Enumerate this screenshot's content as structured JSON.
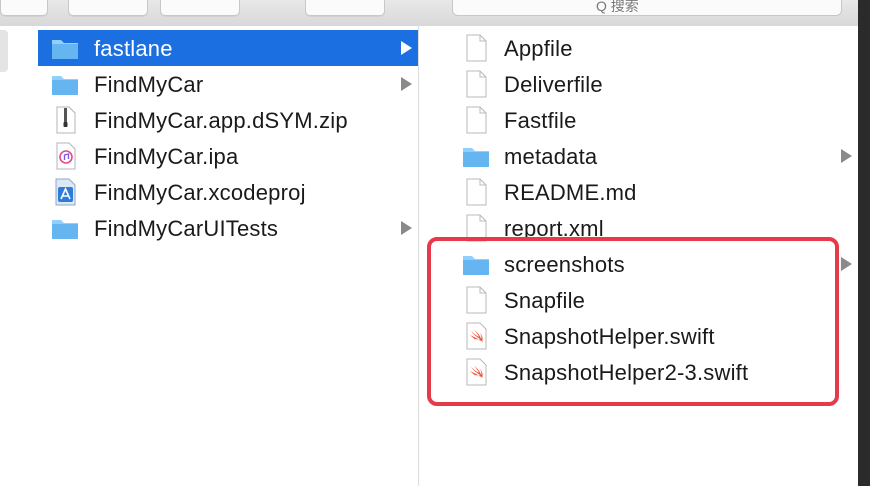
{
  "window": {
    "search_label": "Q 搜索"
  },
  "accent": {
    "selection": "#1c6fe0",
    "annotation": "#e63a4a",
    "folder": "#64b5f0"
  },
  "column1": {
    "items": [
      {
        "label": "fastlane",
        "icon": "folder-icon",
        "selected": true,
        "has_children": true
      },
      {
        "label": "FindMyCar",
        "icon": "folder-icon",
        "selected": false,
        "has_children": true
      },
      {
        "label": "FindMyCar.app.dSYM.zip",
        "icon": "zip-file-icon",
        "selected": false,
        "has_children": false
      },
      {
        "label": "FindMyCar.ipa",
        "icon": "ipa-file-icon",
        "selected": false,
        "has_children": false
      },
      {
        "label": "FindMyCar.xcodeproj",
        "icon": "xcodeproj-icon",
        "selected": false,
        "has_children": false
      },
      {
        "label": "FindMyCarUITests",
        "icon": "folder-icon",
        "selected": false,
        "has_children": true
      }
    ]
  },
  "column2": {
    "items": [
      {
        "label": "Appfile",
        "icon": "document-icon",
        "has_children": false
      },
      {
        "label": "Deliverfile",
        "icon": "document-icon",
        "has_children": false
      },
      {
        "label": "Fastfile",
        "icon": "document-icon",
        "has_children": false
      },
      {
        "label": "metadata",
        "icon": "folder-icon",
        "has_children": true
      },
      {
        "label": "README.md",
        "icon": "document-icon",
        "has_children": false
      },
      {
        "label": "report.xml",
        "icon": "document-icon",
        "has_children": false
      },
      {
        "label": "screenshots",
        "icon": "folder-icon",
        "has_children": true
      },
      {
        "label": "Snapfile",
        "icon": "document-icon",
        "has_children": false
      },
      {
        "label": "SnapshotHelper.swift",
        "icon": "swift-file-icon",
        "has_children": false
      },
      {
        "label": "SnapshotHelper2-3.swift",
        "icon": "swift-file-icon",
        "has_children": false
      }
    ]
  }
}
